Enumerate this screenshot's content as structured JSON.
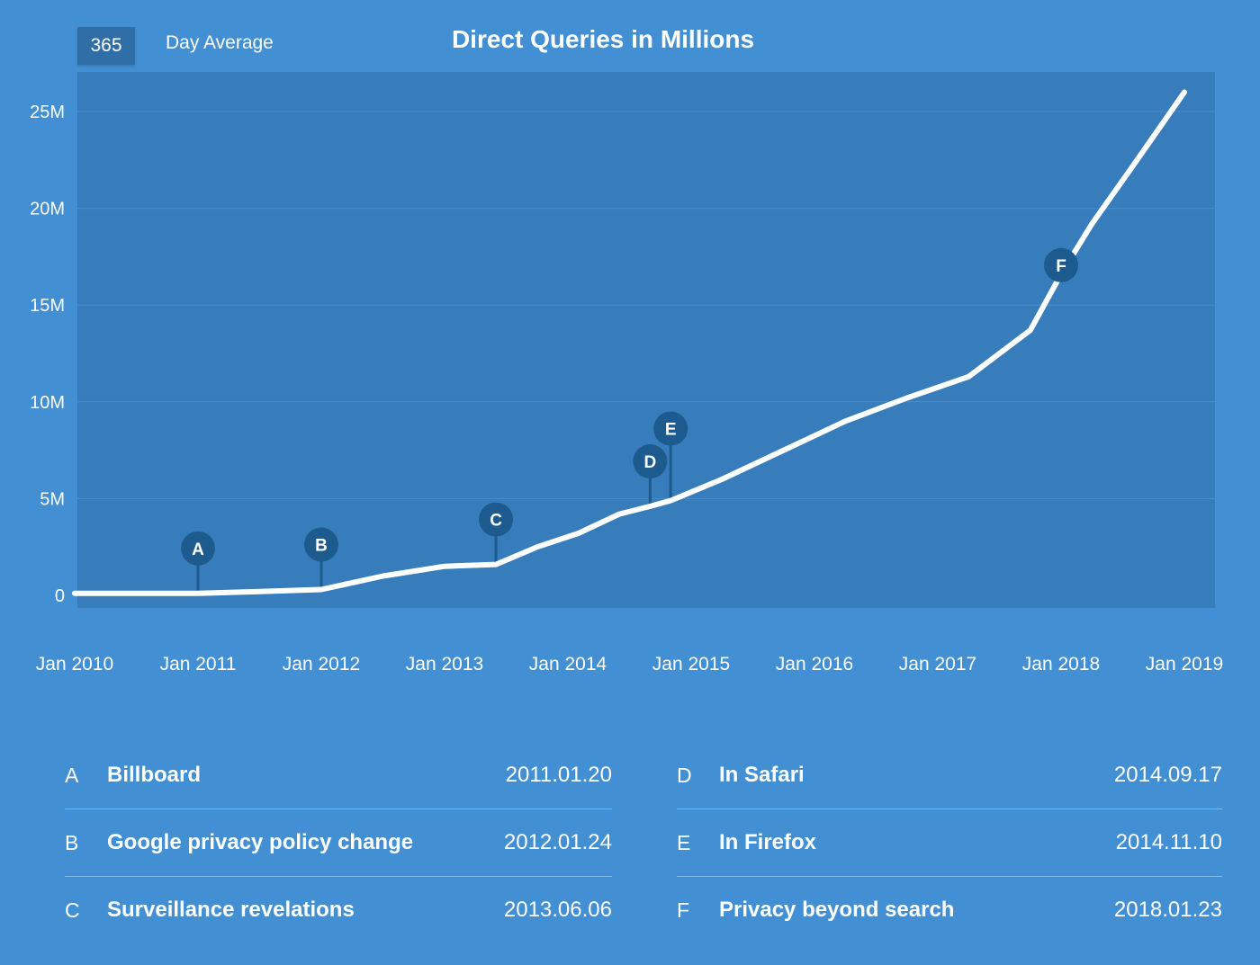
{
  "header": {
    "period_value": "365",
    "period_label": "Day Average"
  },
  "chart_data": {
    "type": "line",
    "title": "Direct Queries in Millions",
    "xlabel": "",
    "ylabel": "",
    "ylim": [
      0,
      27
    ],
    "xlim": [
      "2009-10",
      "2019-03"
    ],
    "y_ticks": [
      {
        "value": 0,
        "label": "0"
      },
      {
        "value": 5,
        "label": "5M"
      },
      {
        "value": 10,
        "label": "10M"
      },
      {
        "value": 15,
        "label": "15M"
      },
      {
        "value": 20,
        "label": "20M"
      },
      {
        "value": 25,
        "label": "25M"
      }
    ],
    "x_ticks": [
      {
        "value": "2010-01",
        "label": "Jan 2010"
      },
      {
        "value": "2011-01",
        "label": "Jan 2011"
      },
      {
        "value": "2012-01",
        "label": "Jan 2012"
      },
      {
        "value": "2013-01",
        "label": "Jan 2013"
      },
      {
        "value": "2014-01",
        "label": "Jan 2014"
      },
      {
        "value": "2015-01",
        "label": "Jan 2015"
      },
      {
        "value": "2016-01",
        "label": "Jan 2016"
      },
      {
        "value": "2017-01",
        "label": "Jan 2017"
      },
      {
        "value": "2018-01",
        "label": "Jan 2018"
      },
      {
        "value": "2019-01",
        "label": "Jan 2019"
      }
    ],
    "grid": true,
    "series": [
      {
        "points": [
          {
            "x": "2010-01",
            "y": 0.1
          },
          {
            "x": "2010-07",
            "y": 0.1
          },
          {
            "x": "2011-01",
            "y": 0.1
          },
          {
            "x": "2011-07",
            "y": 0.2
          },
          {
            "x": "2012-01",
            "y": 0.3
          },
          {
            "x": "2012-07",
            "y": 1.0
          },
          {
            "x": "2013-01",
            "y": 1.5
          },
          {
            "x": "2013-06",
            "y": 1.6
          },
          {
            "x": "2013-10",
            "y": 2.5
          },
          {
            "x": "2014-02",
            "y": 3.2
          },
          {
            "x": "2014-06",
            "y": 4.2
          },
          {
            "x": "2014-09",
            "y": 4.6
          },
          {
            "x": "2014-11",
            "y": 4.9
          },
          {
            "x": "2015-04",
            "y": 6.0
          },
          {
            "x": "2015-10",
            "y": 7.5
          },
          {
            "x": "2016-04",
            "y": 9.0
          },
          {
            "x": "2016-10",
            "y": 10.2
          },
          {
            "x": "2017-04",
            "y": 11.3
          },
          {
            "x": "2017-10",
            "y": 13.7
          },
          {
            "x": "2018-01",
            "y": 16.6
          },
          {
            "x": "2018-04",
            "y": 19.2
          },
          {
            "x": "2018-08",
            "y": 22.2
          },
          {
            "x": "2019-01",
            "y": 26.0
          }
        ]
      }
    ],
    "annotations": [
      {
        "letter": "A",
        "x": "2011-01",
        "y": 0.1,
        "pin": "short"
      },
      {
        "letter": "B",
        "x": "2012-01",
        "y": 0.3,
        "pin": "short"
      },
      {
        "letter": "C",
        "x": "2013-06",
        "y": 1.6,
        "pin": "short"
      },
      {
        "letter": "D",
        "x": "2014-09",
        "y": 4.6,
        "pin": "short"
      },
      {
        "letter": "E",
        "x": "2014-11",
        "y": 4.9,
        "pin": "tall"
      },
      {
        "letter": "F",
        "x": "2018-01",
        "y": 16.6,
        "pin": "none"
      }
    ]
  },
  "events": {
    "left": [
      {
        "letter": "A",
        "name": "Billboard",
        "date": "2011.01.20"
      },
      {
        "letter": "B",
        "name": "Google privacy policy change",
        "date": "2012.01.24"
      },
      {
        "letter": "C",
        "name": "Surveillance revelations",
        "date": "2013.06.06"
      }
    ],
    "right": [
      {
        "letter": "D",
        "name": "In Safari",
        "date": "2014.09.17"
      },
      {
        "letter": "E",
        "name": "In Firefox",
        "date": "2014.11.10"
      },
      {
        "letter": "F",
        "name": "Privacy beyond search",
        "date": "2018.01.23"
      }
    ]
  },
  "colors": {
    "background": "#4290d3",
    "plot_area": "#377dbb",
    "line": "#ffffff",
    "marker": "#1d5b8e",
    "grid": "#4a8ccb",
    "period_box": "#2f6ea6"
  }
}
